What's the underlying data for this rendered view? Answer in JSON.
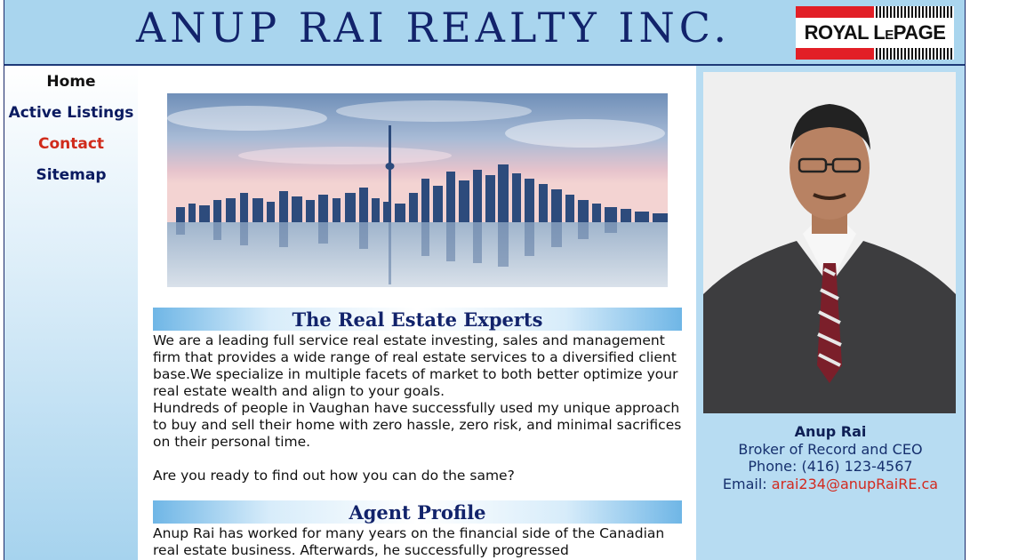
{
  "header": {
    "title": "ANUP RAI REALTY INC.",
    "logo_text": "ROYAL LEPAGE",
    "logo_colors": {
      "red": "#e21f26",
      "black": "#111111"
    }
  },
  "nav": {
    "items": [
      {
        "label": "Home",
        "state": "active"
      },
      {
        "label": "Active Listings"
      },
      {
        "label": "Contact",
        "state": "highlighted"
      },
      {
        "label": "Sitemap"
      }
    ]
  },
  "main": {
    "hero_image": "toronto-skyline-image",
    "sections": [
      {
        "heading": "The Real Estate Experts",
        "paragraphs": [
          "We are a leading full service real estate investing, sales and management firm that provides a wide range of real estate services to a diversified client base.We specialize in multiple facets of market to both better optimize your real estate wealth and align to your goals.",
          "Hundreds of people in Vaughan have successfully used my unique approach to buy and sell their home with zero hassle, zero risk, and minimal sacrifices on their personal time.",
          "Are you ready to find out how you can do the same?"
        ]
      },
      {
        "heading": "Agent Profile",
        "paragraphs": [
          "Anup Rai has worked for many years on the financial side of the Canadian real estate business. Afterwards, he successfully progressed"
        ]
      }
    ]
  },
  "agent": {
    "photo": "agent-portrait-image",
    "name": "Anup Rai",
    "title": "Broker of Record and CEO",
    "phone_label": "Phone:",
    "phone": "(416) 123-4567",
    "email_label": "Email:",
    "email": "arai234@anupRaiRE.ca"
  },
  "colors": {
    "header_bg": "#a9d5ee",
    "title_navy": "#12236b",
    "nav_navy": "#0a1a60",
    "nav_red": "#d02b1b",
    "right_panel_bg": "#b7dcf2",
    "email_red": "#d32a1f"
  }
}
